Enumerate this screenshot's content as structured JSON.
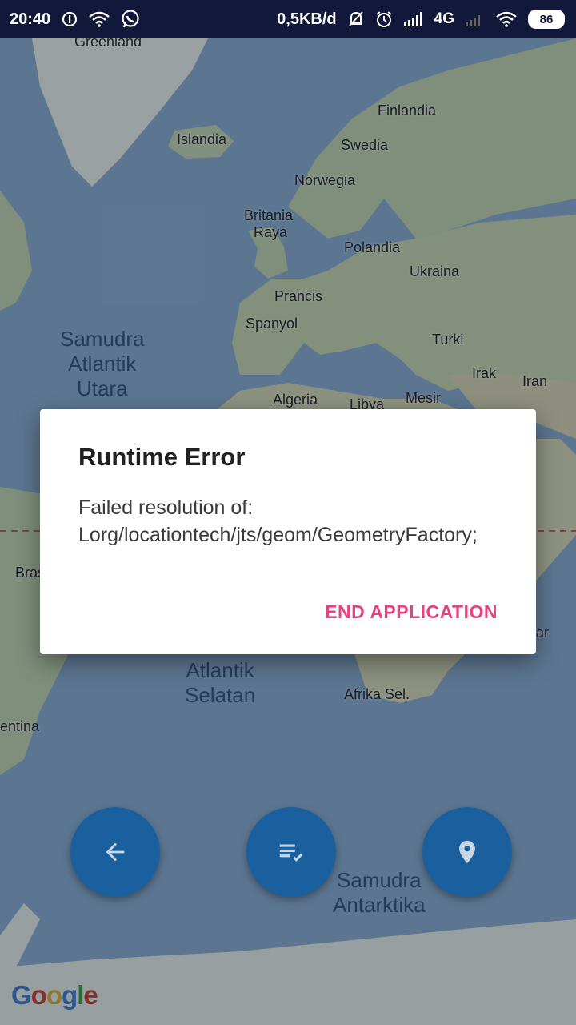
{
  "status_bar": {
    "time": "20:40",
    "data_rate": "0,5KB/d",
    "network": "4G",
    "battery": "86",
    "icons": [
      "vpn-icon",
      "wifi-icon",
      "whatsapp-icon",
      "mute-icon",
      "alarm-icon",
      "signal-icon",
      "signal-empty-icon",
      "wifi-icon",
      "battery-icon"
    ]
  },
  "map": {
    "places": [
      "Greenland",
      "Finlandia",
      "Islandia",
      "Swedia",
      "Norwegia",
      "Britania",
      "Raya",
      "Polandia",
      "Ukraina",
      "Prancis",
      "Spanyol",
      "Turki",
      "Irak",
      "Iran",
      "Algeria",
      "Libya",
      "Mesir",
      "Bras",
      "ar",
      "Afrika Sel.",
      "entina"
    ],
    "oceans": {
      "north_atlantic": [
        "Samudra",
        "Atlantik",
        "Utara"
      ],
      "south_atlantic": [
        "Atlantik",
        "Selatan"
      ],
      "antarctic": [
        "Samudra",
        "Antarktika"
      ]
    },
    "logo": [
      "G",
      "o",
      "o",
      "g",
      "l",
      "e"
    ]
  },
  "fabs": {
    "back": "arrow-left-icon",
    "list": "playlist-check-icon",
    "location": "location-pin-icon"
  },
  "dialog": {
    "title": "Runtime Error",
    "message": "Failed resolution of: Lorg/locationtech/jts/geom/GeometryFactory;",
    "button": "END APPLICATION"
  },
  "colors": {
    "status_bar": "#12183a",
    "fab": "#1a5f9e",
    "accent": "#e8417f",
    "ocean": "#7f9fbf",
    "land": "#b8c7a0"
  }
}
